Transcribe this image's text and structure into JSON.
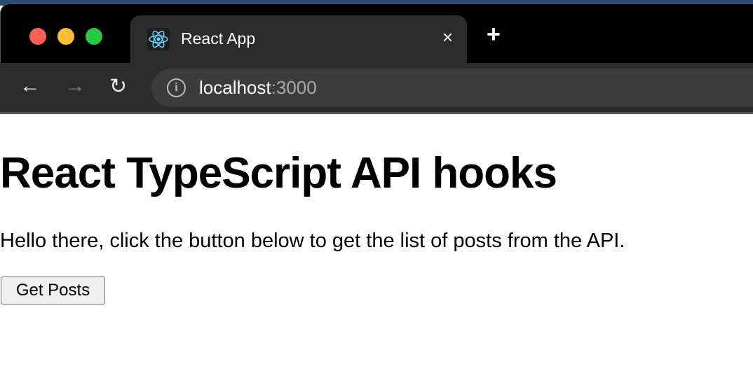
{
  "browser": {
    "tab_title": "React App",
    "tab_icon": "react-logo-icon",
    "close_icon": "×",
    "new_tab_icon": "+",
    "url_host": "localhost",
    "url_port": ":3000",
    "traffic_lights": {
      "close": "#ff5f57",
      "minimize": "#febc2e",
      "zoom": "#28c840"
    }
  },
  "page": {
    "heading": "React TypeScript API hooks",
    "intro": "Hello there, click the button below to get the list of posts from the API.",
    "button_label": "Get Posts"
  }
}
